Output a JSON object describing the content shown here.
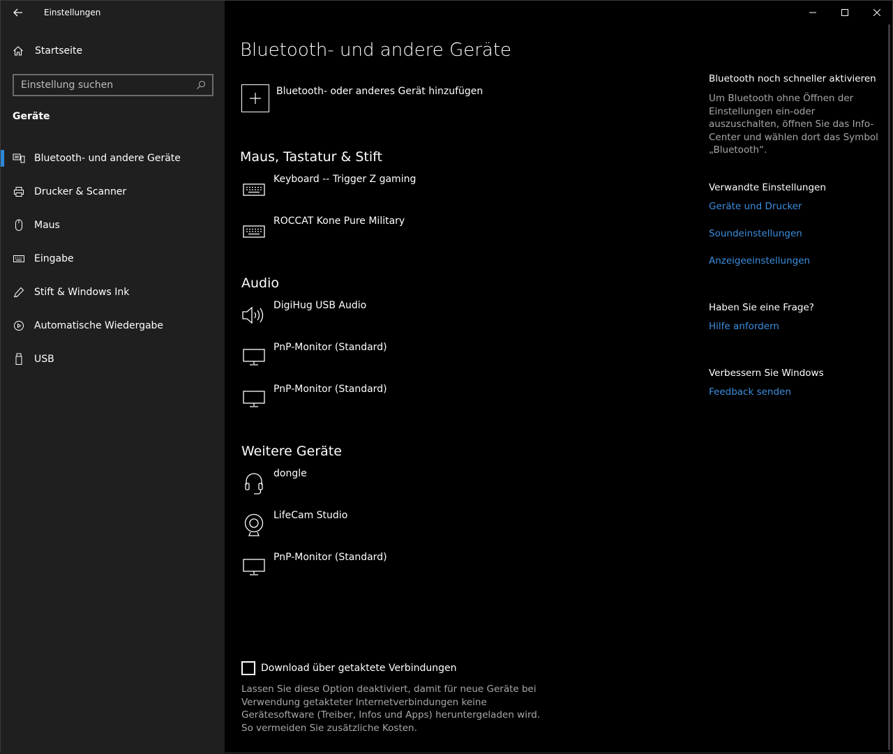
{
  "app": {
    "title": "Einstellungen"
  },
  "sidebar": {
    "home_label": "Startseite",
    "search": {
      "placeholder": "Einstellung suchen"
    },
    "section": "Geräte",
    "items": [
      {
        "label": "Bluetooth- und andere Geräte",
        "icon": "bluetooth-devices-icon",
        "active": true
      },
      {
        "label": "Drucker & Scanner",
        "icon": "printer-icon"
      },
      {
        "label": "Maus",
        "icon": "mouse-icon"
      },
      {
        "label": "Eingabe",
        "icon": "keyboard-icon"
      },
      {
        "label": "Stift & Windows Ink",
        "icon": "pen-icon"
      },
      {
        "label": "Automatische Wiedergabe",
        "icon": "autoplay-icon"
      },
      {
        "label": "USB",
        "icon": "usb-icon"
      }
    ]
  },
  "main": {
    "title": "Bluetooth- und andere Geräte",
    "add_device_label": "Bluetooth- oder anderes Gerät hinzufügen",
    "groups": [
      {
        "title": "Maus, Tastatur & Stift",
        "devices": [
          {
            "name": "Keyboard -- Trigger Z gaming",
            "icon": "keyboard-icon"
          },
          {
            "name": "ROCCAT Kone Pure Military",
            "icon": "keyboard-icon"
          }
        ]
      },
      {
        "title": "Audio",
        "devices": [
          {
            "name": "DigiHug USB Audio",
            "icon": "speaker-icon"
          },
          {
            "name": "PnP-Monitor (Standard)",
            "icon": "monitor-icon"
          },
          {
            "name": "PnP-Monitor (Standard)",
            "icon": "monitor-icon"
          }
        ]
      },
      {
        "title": "Weitere Geräte",
        "devices": [
          {
            "name": "dongle",
            "icon": "headset-icon"
          },
          {
            "name": "LifeCam Studio",
            "icon": "webcam-icon"
          },
          {
            "name": "PnP-Monitor (Standard)",
            "icon": "monitor-icon"
          }
        ]
      }
    ],
    "metered": {
      "label": "Download über getaktete Verbindungen",
      "checked": false,
      "description": "Lassen Sie diese Option deaktiviert, damit für neue Geräte bei Verwendung getakteter Internetverbindungen keine Gerätesoftware (Treiber, Infos und Apps) heruntergeladen wird. So vermeiden Sie zusätzliche Kosten."
    }
  },
  "right": {
    "quick": {
      "heading": "Bluetooth noch schneller aktivieren",
      "text": "Um Bluetooth ohne Öffnen der Einstellungen ein-oder auszuschalten, öffnen Sie das Info-Center und wählen dort das Symbol „Bluetooth“."
    },
    "related": {
      "heading": "Verwandte Einstellungen",
      "links": [
        "Geräte und Drucker",
        "Soundeinstellungen",
        "Anzeigeeinstellungen"
      ]
    },
    "question": {
      "heading": "Haben Sie eine Frage?",
      "link": "Hilfe anfordern"
    },
    "improve": {
      "heading": "Verbessern Sie Windows",
      "link": "Feedback senden"
    }
  },
  "colors": {
    "accent": "#2b88d8",
    "link": "#3d8fe0",
    "sidebar_bg": "#1f1f1f",
    "main_bg": "#000000"
  }
}
